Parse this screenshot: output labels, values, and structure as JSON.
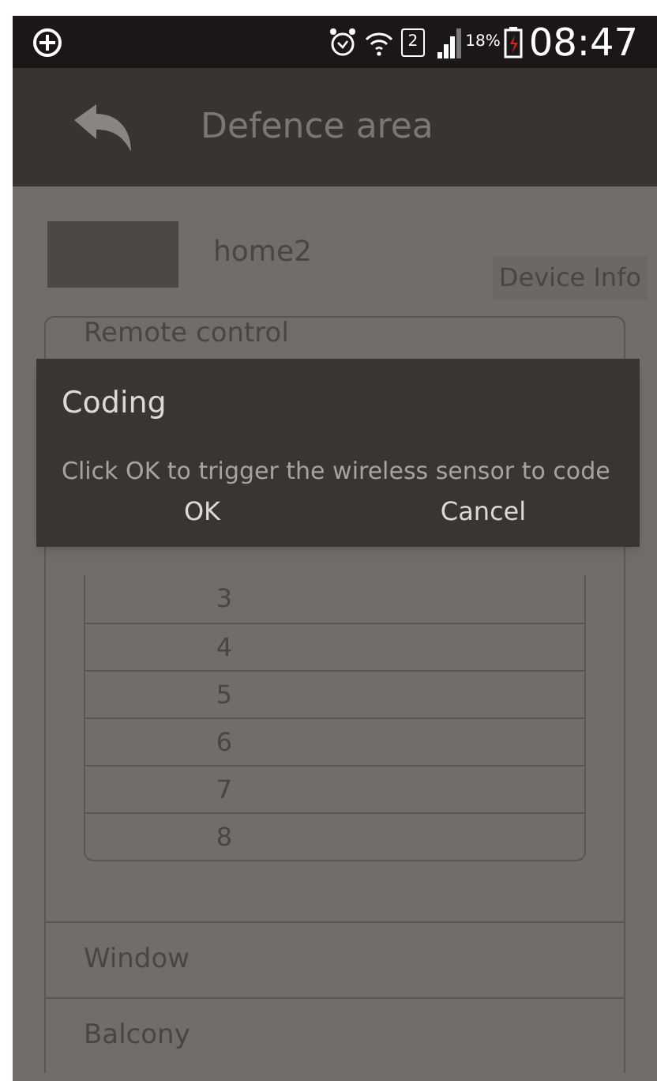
{
  "status_bar": {
    "sim_slot": "2",
    "battery_percent": "18%",
    "time": "08:47"
  },
  "header": {
    "title": "Defence area"
  },
  "device": {
    "name": "home2",
    "info_button": "Device Info"
  },
  "groups": [
    {
      "label": "Remote control",
      "expanded": true,
      "zones": [
        "3",
        "4",
        "5",
        "6",
        "7",
        "8"
      ]
    },
    {
      "label": "Window",
      "expanded": false
    },
    {
      "label": "Balcony",
      "expanded": false
    }
  ],
  "dialog": {
    "title": "Coding",
    "message": "Click OK to trigger the wireless sensor to code",
    "buttons": [
      "OK",
      "Cancel"
    ]
  }
}
